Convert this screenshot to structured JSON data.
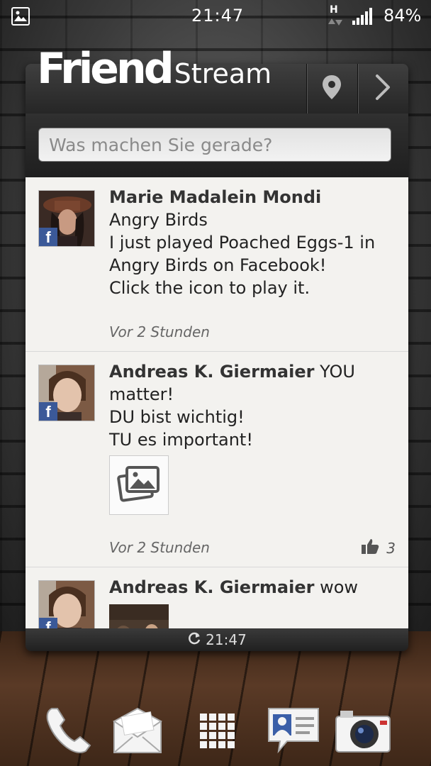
{
  "status_bar": {
    "time": "21:47",
    "network": "H",
    "battery": "84%",
    "icons": [
      "gallery-icon",
      "hspa-icon",
      "signal-icon"
    ]
  },
  "widget": {
    "brand_bold": "Friend",
    "brand_light": "Stream",
    "header_icons": [
      "location-pin-icon",
      "chevron-right-icon"
    ],
    "search_placeholder": "Was machen Sie gerade?",
    "posts": [
      {
        "author": "Marie Madalein Mondi",
        "lines": [
          "Angry Birds",
          "I just played Poached Eggs-1 in",
          "Angry Birds on Facebook!",
          "Click the icon to play it."
        ],
        "time": "Vor 2 Stunden",
        "source_icon": "facebook-icon"
      },
      {
        "author": "Andreas K. Giermaier",
        "text_after_name": "YOU",
        "lines": [
          "matter!",
          "DU bist wichtig!",
          "TU es important!"
        ],
        "time": "Vor 2 Stunden",
        "likes": "3",
        "source_icon": "facebook-icon"
      },
      {
        "author": "Andreas K. Giermaier",
        "text_after_name": "wow",
        "source_icon": "facebook-icon"
      }
    ],
    "footer_time": "21:47"
  },
  "dock": [
    "phone-icon",
    "mail-icon",
    "app-drawer-icon",
    "people-icon",
    "camera-icon"
  ],
  "colors": {
    "facebook": "#3b5998",
    "feed_bg": "#f3f2ef",
    "header_bg": "#2e2e2e"
  }
}
